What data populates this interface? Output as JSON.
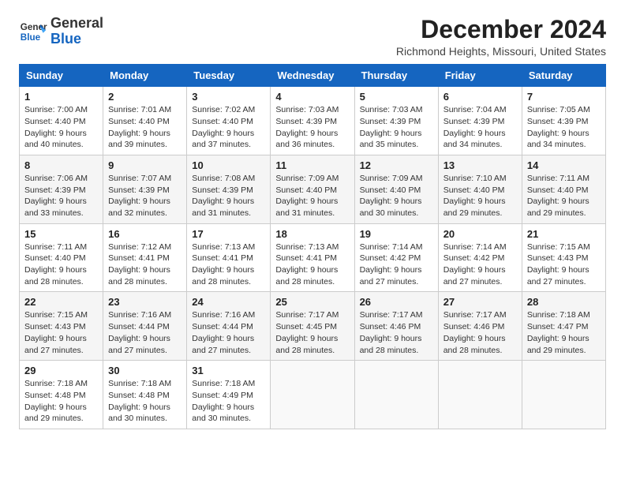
{
  "logo": {
    "line1": "General",
    "line2": "Blue"
  },
  "title": "December 2024",
  "subtitle": "Richmond Heights, Missouri, United States",
  "days_of_week": [
    "Sunday",
    "Monday",
    "Tuesday",
    "Wednesday",
    "Thursday",
    "Friday",
    "Saturday"
  ],
  "weeks": [
    [
      {
        "day": "1",
        "sunrise": "7:00 AM",
        "sunset": "4:40 PM",
        "daylight": "9 hours and 40 minutes."
      },
      {
        "day": "2",
        "sunrise": "7:01 AM",
        "sunset": "4:40 PM",
        "daylight": "9 hours and 39 minutes."
      },
      {
        "day": "3",
        "sunrise": "7:02 AM",
        "sunset": "4:40 PM",
        "daylight": "9 hours and 37 minutes."
      },
      {
        "day": "4",
        "sunrise": "7:03 AM",
        "sunset": "4:39 PM",
        "daylight": "9 hours and 36 minutes."
      },
      {
        "day": "5",
        "sunrise": "7:03 AM",
        "sunset": "4:39 PM",
        "daylight": "9 hours and 35 minutes."
      },
      {
        "day": "6",
        "sunrise": "7:04 AM",
        "sunset": "4:39 PM",
        "daylight": "9 hours and 34 minutes."
      },
      {
        "day": "7",
        "sunrise": "7:05 AM",
        "sunset": "4:39 PM",
        "daylight": "9 hours and 34 minutes."
      }
    ],
    [
      {
        "day": "8",
        "sunrise": "7:06 AM",
        "sunset": "4:39 PM",
        "daylight": "9 hours and 33 minutes."
      },
      {
        "day": "9",
        "sunrise": "7:07 AM",
        "sunset": "4:39 PM",
        "daylight": "9 hours and 32 minutes."
      },
      {
        "day": "10",
        "sunrise": "7:08 AM",
        "sunset": "4:39 PM",
        "daylight": "9 hours and 31 minutes."
      },
      {
        "day": "11",
        "sunrise": "7:09 AM",
        "sunset": "4:40 PM",
        "daylight": "9 hours and 31 minutes."
      },
      {
        "day": "12",
        "sunrise": "7:09 AM",
        "sunset": "4:40 PM",
        "daylight": "9 hours and 30 minutes."
      },
      {
        "day": "13",
        "sunrise": "7:10 AM",
        "sunset": "4:40 PM",
        "daylight": "9 hours and 29 minutes."
      },
      {
        "day": "14",
        "sunrise": "7:11 AM",
        "sunset": "4:40 PM",
        "daylight": "9 hours and 29 minutes."
      }
    ],
    [
      {
        "day": "15",
        "sunrise": "7:11 AM",
        "sunset": "4:40 PM",
        "daylight": "9 hours and 28 minutes."
      },
      {
        "day": "16",
        "sunrise": "7:12 AM",
        "sunset": "4:41 PM",
        "daylight": "9 hours and 28 minutes."
      },
      {
        "day": "17",
        "sunrise": "7:13 AM",
        "sunset": "4:41 PM",
        "daylight": "9 hours and 28 minutes."
      },
      {
        "day": "18",
        "sunrise": "7:13 AM",
        "sunset": "4:41 PM",
        "daylight": "9 hours and 28 minutes."
      },
      {
        "day": "19",
        "sunrise": "7:14 AM",
        "sunset": "4:42 PM",
        "daylight": "9 hours and 27 minutes."
      },
      {
        "day": "20",
        "sunrise": "7:14 AM",
        "sunset": "4:42 PM",
        "daylight": "9 hours and 27 minutes."
      },
      {
        "day": "21",
        "sunrise": "7:15 AM",
        "sunset": "4:43 PM",
        "daylight": "9 hours and 27 minutes."
      }
    ],
    [
      {
        "day": "22",
        "sunrise": "7:15 AM",
        "sunset": "4:43 PM",
        "daylight": "9 hours and 27 minutes."
      },
      {
        "day": "23",
        "sunrise": "7:16 AM",
        "sunset": "4:44 PM",
        "daylight": "9 hours and 27 minutes."
      },
      {
        "day": "24",
        "sunrise": "7:16 AM",
        "sunset": "4:44 PM",
        "daylight": "9 hours and 27 minutes."
      },
      {
        "day": "25",
        "sunrise": "7:17 AM",
        "sunset": "4:45 PM",
        "daylight": "9 hours and 28 minutes."
      },
      {
        "day": "26",
        "sunrise": "7:17 AM",
        "sunset": "4:46 PM",
        "daylight": "9 hours and 28 minutes."
      },
      {
        "day": "27",
        "sunrise": "7:17 AM",
        "sunset": "4:46 PM",
        "daylight": "9 hours and 28 minutes."
      },
      {
        "day": "28",
        "sunrise": "7:18 AM",
        "sunset": "4:47 PM",
        "daylight": "9 hours and 29 minutes."
      }
    ],
    [
      {
        "day": "29",
        "sunrise": "7:18 AM",
        "sunset": "4:48 PM",
        "daylight": "9 hours and 29 minutes."
      },
      {
        "day": "30",
        "sunrise": "7:18 AM",
        "sunset": "4:48 PM",
        "daylight": "9 hours and 30 minutes."
      },
      {
        "day": "31",
        "sunrise": "7:18 AM",
        "sunset": "4:49 PM",
        "daylight": "9 hours and 30 minutes."
      },
      null,
      null,
      null,
      null
    ]
  ]
}
